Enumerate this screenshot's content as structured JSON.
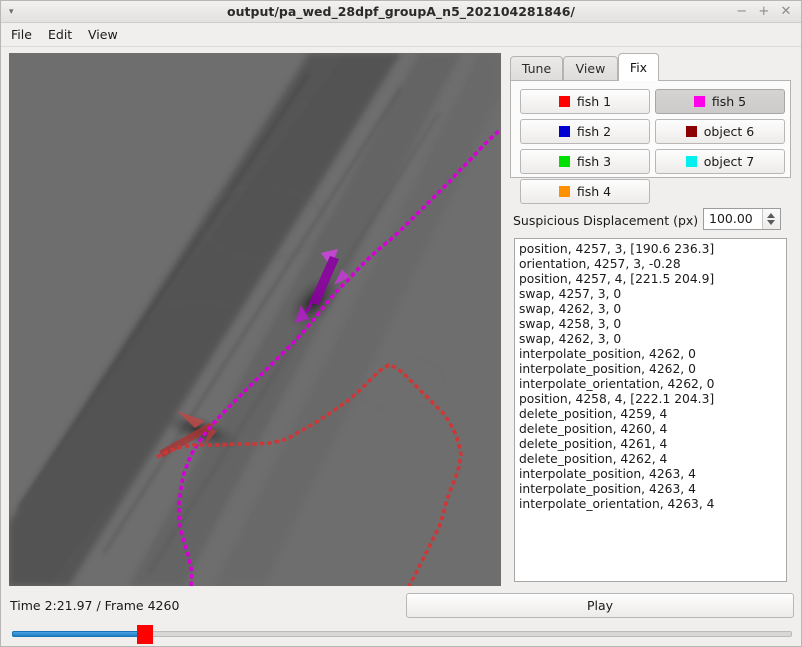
{
  "window": {
    "title": "output/pa_wed_28dpf_groupA_n5_202104281846/",
    "menu_icon": "▾",
    "minimize": "−",
    "maximize": "+",
    "close": "✕"
  },
  "menubar": {
    "items": [
      "File",
      "Edit",
      "View"
    ]
  },
  "tabs": [
    {
      "label": "Tune",
      "active": false
    },
    {
      "label": "View",
      "active": false
    },
    {
      "label": "Fix",
      "active": true
    }
  ],
  "identity_buttons": [
    {
      "label": "fish 1",
      "color": "#ff0000",
      "pressed": false
    },
    {
      "label": "fish 2",
      "color": "#0000d2",
      "pressed": false
    },
    {
      "label": "fish 3",
      "color": "#00e000",
      "pressed": false
    },
    {
      "label": "fish 4",
      "color": "#ff9000",
      "pressed": false
    },
    {
      "label": "fish 5",
      "color": "#ff00ea",
      "pressed": true
    },
    {
      "label": "object 6",
      "color": "#8b0000",
      "pressed": false
    },
    {
      "label": "object 7",
      "color": "#00f0f0",
      "pressed": false
    }
  ],
  "suspicious": {
    "label": "Suspicious Displacement (px)",
    "value": "100.00",
    "up_arrow": "▲",
    "down_arrow": "▼"
  },
  "log": {
    "lines": [
      "position, 4257, 3, [190.6 236.3]",
      "orientation, 4257, 3, -0.28",
      "position, 4257, 4, [221.5 204.9]",
      "swap, 4257, 3, 0",
      "swap, 4262, 3, 0",
      "swap, 4258, 3, 0",
      "swap, 4262, 3, 0",
      "interpolate_position, 4262, 0",
      "interpolate_position, 4262, 0",
      "interpolate_orientation, 4262, 0",
      "position, 4258, 4, [222.1 204.3]",
      "delete_position, 4259, 4",
      "delete_position, 4260, 4",
      "delete_position, 4261, 4",
      "delete_position, 4262, 4",
      "interpolate_position, 4263, 4",
      "interpolate_position, 4263, 4",
      "interpolate_orientation, 4263, 4"
    ]
  },
  "playback": {
    "status": "Time 2:21.97 / Frame 4260",
    "play_label": "Play",
    "progress_percent": 17,
    "handle_color": "#fe0000",
    "fill_color": "#2f8fd0"
  },
  "viewport": {
    "background": "#6e6e6e",
    "track_colors": {
      "fish5": "#d500d5",
      "fish1": "#cc3838"
    }
  }
}
